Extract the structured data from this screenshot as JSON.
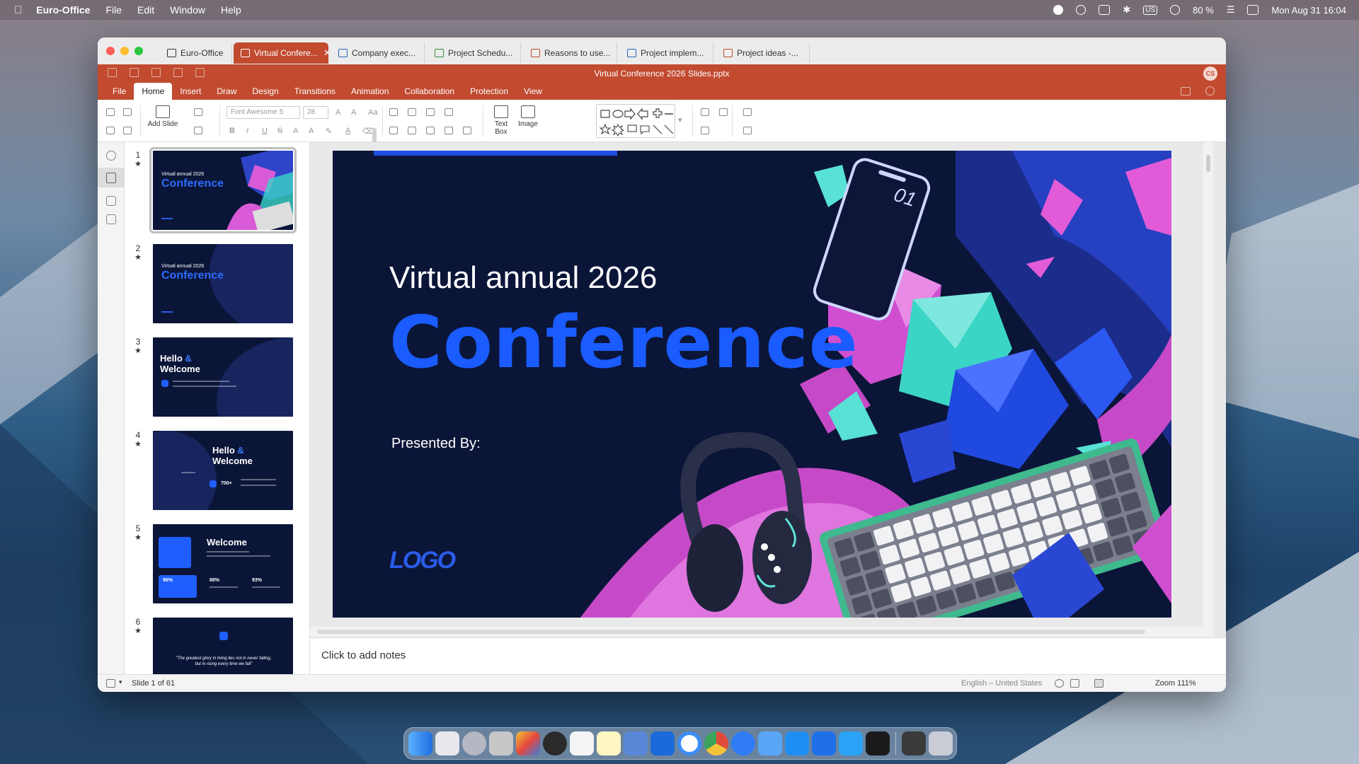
{
  "menubar": {
    "app_name": "Euro-Office",
    "items": [
      "File",
      "Edit",
      "Window",
      "Help"
    ],
    "input_source": "US",
    "battery": "80 %",
    "datetime": "Mon Aug 31  16:04"
  },
  "tabs": [
    {
      "label": "Euro-Office",
      "type": "home"
    },
    {
      "label": "Virtual Confere...",
      "type": "ppt",
      "active": true
    },
    {
      "label": "Company exec...",
      "type": "doc"
    },
    {
      "label": "Project Schedu...",
      "type": "sheet"
    },
    {
      "label": "Reasons to use...",
      "type": "ppt"
    },
    {
      "label": "Project implem...",
      "type": "doc"
    },
    {
      "label": "Project ideas -...",
      "type": "ppt"
    }
  ],
  "document_title": "Virtual Conference 2026 Slides.pptx",
  "user_initials": "CS",
  "ribbon_tabs": [
    "File",
    "Home",
    "Insert",
    "Draw",
    "Design",
    "Transitions",
    "Animation",
    "Collaboration",
    "Protection",
    "View"
  ],
  "toolbar": {
    "add_slide": "Add Slide",
    "font_name": "Font Awesome 5",
    "font_size": "28",
    "text_box": "Text Box",
    "image": "Image"
  },
  "thumbnails": [
    {
      "num": "1",
      "line1": "Virtual annual 2026",
      "line2": "Conference"
    },
    {
      "num": "2",
      "line1": "Virtual annual 2026",
      "line2": "Conference"
    },
    {
      "num": "3",
      "hello": "Hello",
      "amp": "&",
      "welcome": "Welcome"
    },
    {
      "num": "4",
      "hello": "Hello",
      "amp": "&",
      "welcome": "Welcome",
      "stat": "700+"
    },
    {
      "num": "5",
      "welcome": "Welcome",
      "s1": "96%",
      "s2": "88%",
      "s3": "93%"
    },
    {
      "num": "6",
      "quote": "\"The greatest glory in living lies not in never falling, but in rising every time we fall\""
    }
  ],
  "slide": {
    "subtitle": "Virtual annual 2026",
    "headline": "Conference",
    "presented_by": "Presented By:",
    "logo": "LOGO",
    "phone_number": "01"
  },
  "notes_placeholder": "Click to add notes",
  "status": {
    "slide_number": "Slide 1 of 61",
    "language": "English – United States",
    "zoom": "Zoom 111%"
  },
  "colors": {
    "accent": "#c14a2f",
    "slide_bg": "#0b1538",
    "headline_blue": "#1a5cff"
  }
}
